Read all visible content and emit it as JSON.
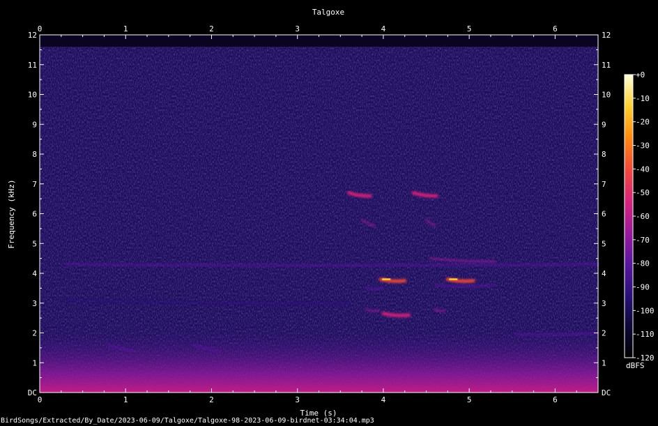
{
  "chart_data": {
    "type": "heatmap",
    "title": "Talgoxe",
    "xlabel": "Time (s)",
    "ylabel": "Frequency (kHz)",
    "xlim": [
      0,
      6.5
    ],
    "ylim": [
      0,
      12
    ],
    "x_ticks": [
      0,
      1,
      2,
      3,
      4,
      5,
      6
    ],
    "x_tick_labels": [
      "0",
      "1",
      "2",
      "3",
      "4",
      "5",
      "6"
    ],
    "y_ticks": [
      0,
      1,
      2,
      3,
      4,
      5,
      6,
      7,
      8,
      9,
      10,
      11,
      12
    ],
    "y_tick_labels": [
      "DC",
      "1",
      "2",
      "3",
      "4",
      "5",
      "6",
      "7",
      "8",
      "9",
      "10",
      "11",
      "12"
    ],
    "colorbar": {
      "label": "dBFS",
      "range": [
        -120,
        0
      ],
      "ticks": [
        0,
        -10,
        -20,
        -30,
        -40,
        -50,
        -60,
        -70,
        -80,
        -90,
        -100,
        -110,
        -120
      ],
      "tick_labels": [
        "+0",
        "-10",
        "-20",
        "-30",
        "-40",
        "-50",
        "-60",
        "-70",
        "-80",
        "-90",
        "-100",
        "-110",
        "-120"
      ],
      "colormap": [
        "#000000",
        "#0d0838",
        "#2a117a",
        "#5a16a0",
        "#9b1a9c",
        "#d8247a",
        "#f24a3a",
        "#ff8a10",
        "#ffd030",
        "#ffffd8"
      ]
    },
    "background_level_dbfs": -100,
    "content_top_khz": 11.6,
    "calls": [
      {
        "t0": 3.6,
        "t1": 3.85,
        "f_start": 6.7,
        "f_end": 6.6,
        "level_dbfs": -50
      },
      {
        "t0": 4.35,
        "t1": 4.62,
        "f_start": 6.7,
        "f_end": 6.6,
        "level_dbfs": -50
      },
      {
        "t0": 3.97,
        "t1": 4.25,
        "f_start": 3.8,
        "f_end": 3.75,
        "level_dbfs": -35
      },
      {
        "t0": 4.75,
        "t1": 5.05,
        "f_start": 3.8,
        "f_end": 3.75,
        "level_dbfs": -35
      },
      {
        "t0": 3.8,
        "t1": 4.0,
        "f_start": 3.5,
        "f_end": 3.5,
        "level_dbfs": -75
      },
      {
        "t0": 4.6,
        "t1": 5.3,
        "f_start": 3.6,
        "f_end": 3.6,
        "level_dbfs": -78
      },
      {
        "t0": 4.55,
        "t1": 5.3,
        "f_start": 4.5,
        "f_end": 4.4,
        "level_dbfs": -70
      },
      {
        "t0": 4.0,
        "t1": 4.3,
        "f_start": 2.65,
        "f_end": 2.6,
        "level_dbfs": -58
      },
      {
        "t0": 3.8,
        "t1": 3.95,
        "f_start": 2.8,
        "f_end": 2.75,
        "level_dbfs": -62
      },
      {
        "t0": 4.6,
        "t1": 4.72,
        "f_start": 2.8,
        "f_end": 2.75,
        "level_dbfs": -62
      },
      {
        "t0": 3.75,
        "t1": 3.9,
        "f_start": 5.8,
        "f_end": 5.6,
        "level_dbfs": -68
      },
      {
        "t0": 4.5,
        "t1": 4.6,
        "f_start": 5.8,
        "f_end": 5.6,
        "level_dbfs": -68
      },
      {
        "t0": 0.8,
        "t1": 1.1,
        "f_start": 1.6,
        "f_end": 1.4,
        "level_dbfs": -78
      },
      {
        "t0": 1.8,
        "t1": 2.1,
        "f_start": 1.6,
        "f_end": 1.4,
        "level_dbfs": -80
      },
      {
        "t0": 5.55,
        "t1": 6.5,
        "f_start": 1.95,
        "f_end": 2.0,
        "level_dbfs": -78
      },
      {
        "t0": 0.3,
        "t1": 6.5,
        "f_start": 4.3,
        "f_end": 4.3,
        "level_dbfs": -85
      },
      {
        "t0": 0.3,
        "t1": 3.6,
        "f_start": 3.1,
        "f_end": 3.0,
        "level_dbfs": -88
      }
    ]
  },
  "source_path": "BirdSongs/Extracted/By_Date/2023-06-09/Talgoxe/Talgoxe-98-2023-06-09-birdnet-03:34:04.mp3"
}
